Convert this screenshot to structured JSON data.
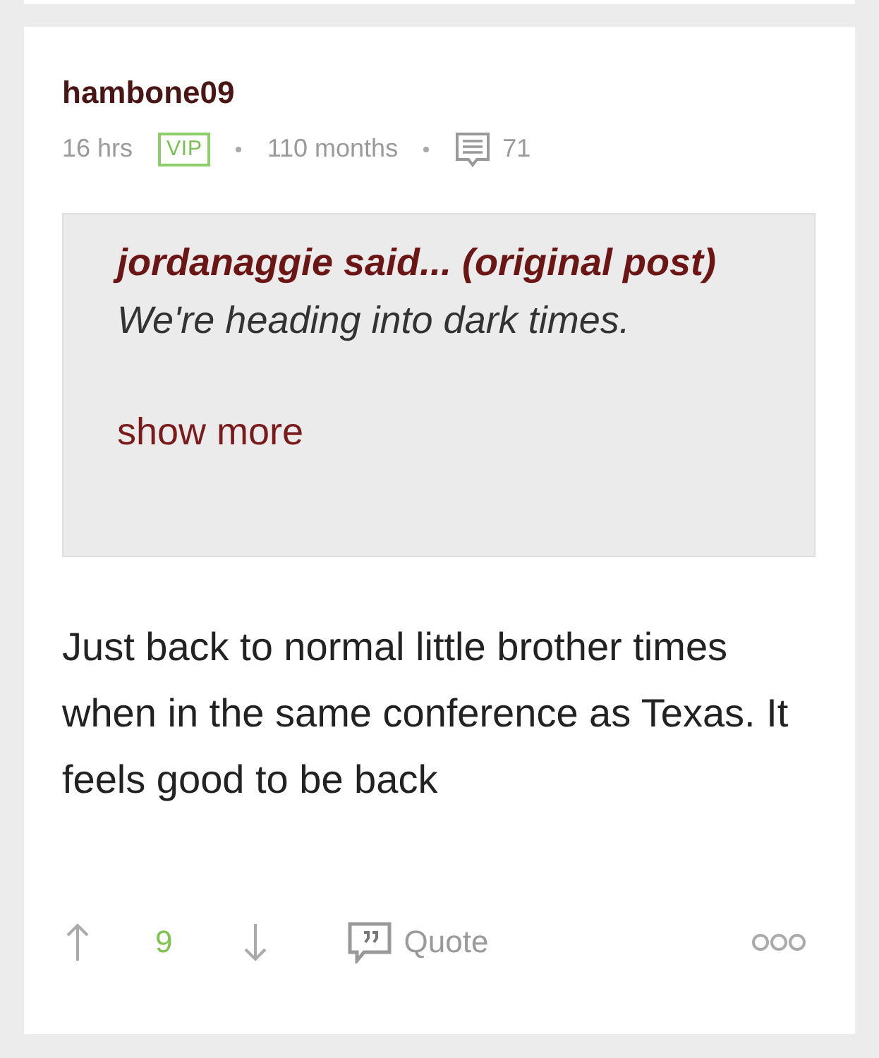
{
  "post": {
    "author": "hambone09",
    "time": "16 hrs",
    "badge": "VIP",
    "tenure": "110 months",
    "post_count": "71",
    "quote": {
      "text": "**jordanaggie said... (original post)** We're heading into dark times.",
      "more": "show more"
    },
    "body": "Just back to normal little brother times when in the same conference as Texas. It feels good to be back",
    "votes": "9",
    "quote_button": "Quote"
  }
}
